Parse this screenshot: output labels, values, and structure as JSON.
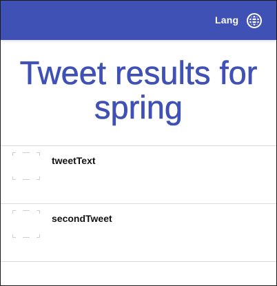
{
  "toolbar": {
    "lang_label": "Lang",
    "globe_icon": "globe-icon",
    "background": "#3f51b5"
  },
  "page": {
    "title": "Tweet results for spring"
  },
  "tweets": [
    {
      "text": "tweetText",
      "avatar": "broken-image"
    },
    {
      "text": "secondTweet",
      "avatar": "broken-image"
    }
  ],
  "colors": {
    "accent": "#3f51b5",
    "divider": "#dcdcdc",
    "text": "#111111"
  }
}
